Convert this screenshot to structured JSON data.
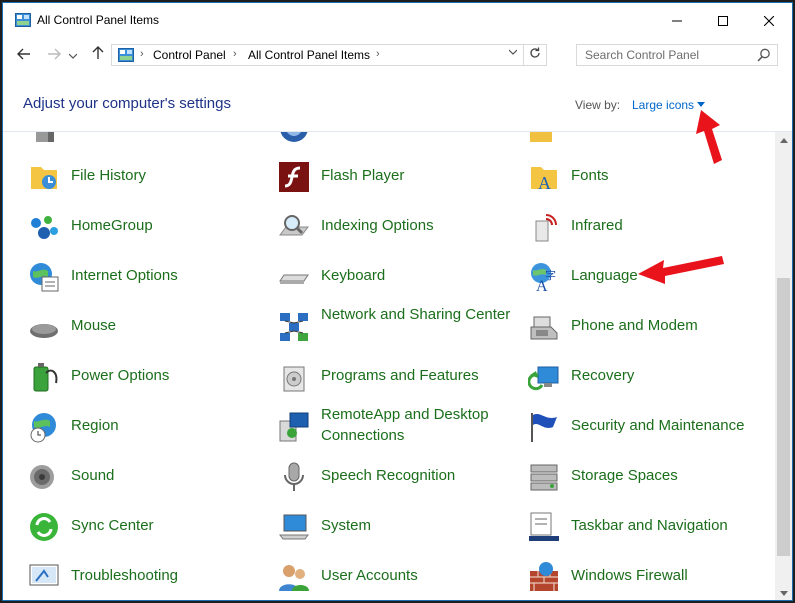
{
  "window": {
    "title": "All Control Panel Items"
  },
  "address": {
    "segments": [
      "Control Panel",
      "All Control Panel Items"
    ]
  },
  "search": {
    "placeholder": "Search Control Panel"
  },
  "header": {
    "heading": "Adjust your computer's settings",
    "view_by_label": "View by:",
    "view_by_value": "Large icons"
  },
  "items": [
    {
      "label": "File History",
      "icon": "file-history-icon"
    },
    {
      "label": "Flash Player",
      "icon": "flash-player-icon"
    },
    {
      "label": "Fonts",
      "icon": "fonts-icon"
    },
    {
      "label": "HomeGroup",
      "icon": "homegroup-icon"
    },
    {
      "label": "Indexing Options",
      "icon": "indexing-options-icon"
    },
    {
      "label": "Infrared",
      "icon": "infrared-icon"
    },
    {
      "label": "Internet Options",
      "icon": "internet-options-icon"
    },
    {
      "label": "Keyboard",
      "icon": "keyboard-icon"
    },
    {
      "label": "Language",
      "icon": "language-icon"
    },
    {
      "label": "Mouse",
      "icon": "mouse-icon"
    },
    {
      "label": "Network and Sharing Center",
      "icon": "network-icon"
    },
    {
      "label": "Phone and Modem",
      "icon": "phone-modem-icon"
    },
    {
      "label": "Power Options",
      "icon": "power-options-icon"
    },
    {
      "label": "Programs and Features",
      "icon": "programs-features-icon"
    },
    {
      "label": "Recovery",
      "icon": "recovery-icon"
    },
    {
      "label": "Region",
      "icon": "region-icon"
    },
    {
      "label": "RemoteApp and Desktop Connections",
      "icon": "remoteapp-icon"
    },
    {
      "label": "Security and Maintenance",
      "icon": "security-maintenance-icon"
    },
    {
      "label": "Sound",
      "icon": "sound-icon"
    },
    {
      "label": "Speech Recognition",
      "icon": "speech-recognition-icon"
    },
    {
      "label": "Storage Spaces",
      "icon": "storage-spaces-icon"
    },
    {
      "label": "Sync Center",
      "icon": "sync-center-icon"
    },
    {
      "label": "System",
      "icon": "system-icon"
    },
    {
      "label": "Taskbar and Navigation",
      "icon": "taskbar-icon"
    },
    {
      "label": "Troubleshooting",
      "icon": "troubleshooting-icon"
    },
    {
      "label": "User Accounts",
      "icon": "user-accounts-icon"
    },
    {
      "label": "Windows Firewall",
      "icon": "windows-firewall-icon"
    }
  ],
  "colors": {
    "item_text": "#1b6e1b",
    "heading": "#1e3287",
    "link": "#0066cc",
    "annotation": "#e8131b"
  }
}
